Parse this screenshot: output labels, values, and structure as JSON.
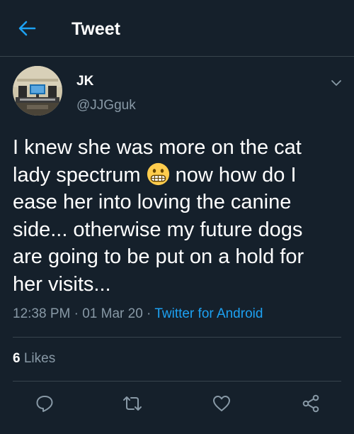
{
  "header": {
    "back_icon": "arrow-left-icon",
    "title": "Tweet"
  },
  "author": {
    "name": "JK",
    "handle": "@JJGguk"
  },
  "tweet": {
    "line1": "I knew she was more on the cat",
    "line2a": "lady spectrum ",
    "line2b": " now how do I",
    "line3": "ease her into loving the canine",
    "line4": "side... otherwise my future dogs",
    "line5": "are going to be put on a hold for",
    "line6": "her visits...",
    "emoji": "grimacing-face-emoji"
  },
  "meta": {
    "time": "12:38 PM",
    "sep1": " · ",
    "date": "01 Mar 20",
    "sep2": " · ",
    "source": "Twitter for Android"
  },
  "stats": {
    "likes_count": "6",
    "likes_label": " Likes"
  },
  "actions": [
    "reply-icon",
    "retweet-icon",
    "like-icon",
    "share-icon"
  ],
  "colors": {
    "background": "#15202b",
    "accent": "#1da1f2",
    "secondary_text": "#8899a6",
    "divider": "#38444d",
    "primary_text": "#ffffff"
  }
}
